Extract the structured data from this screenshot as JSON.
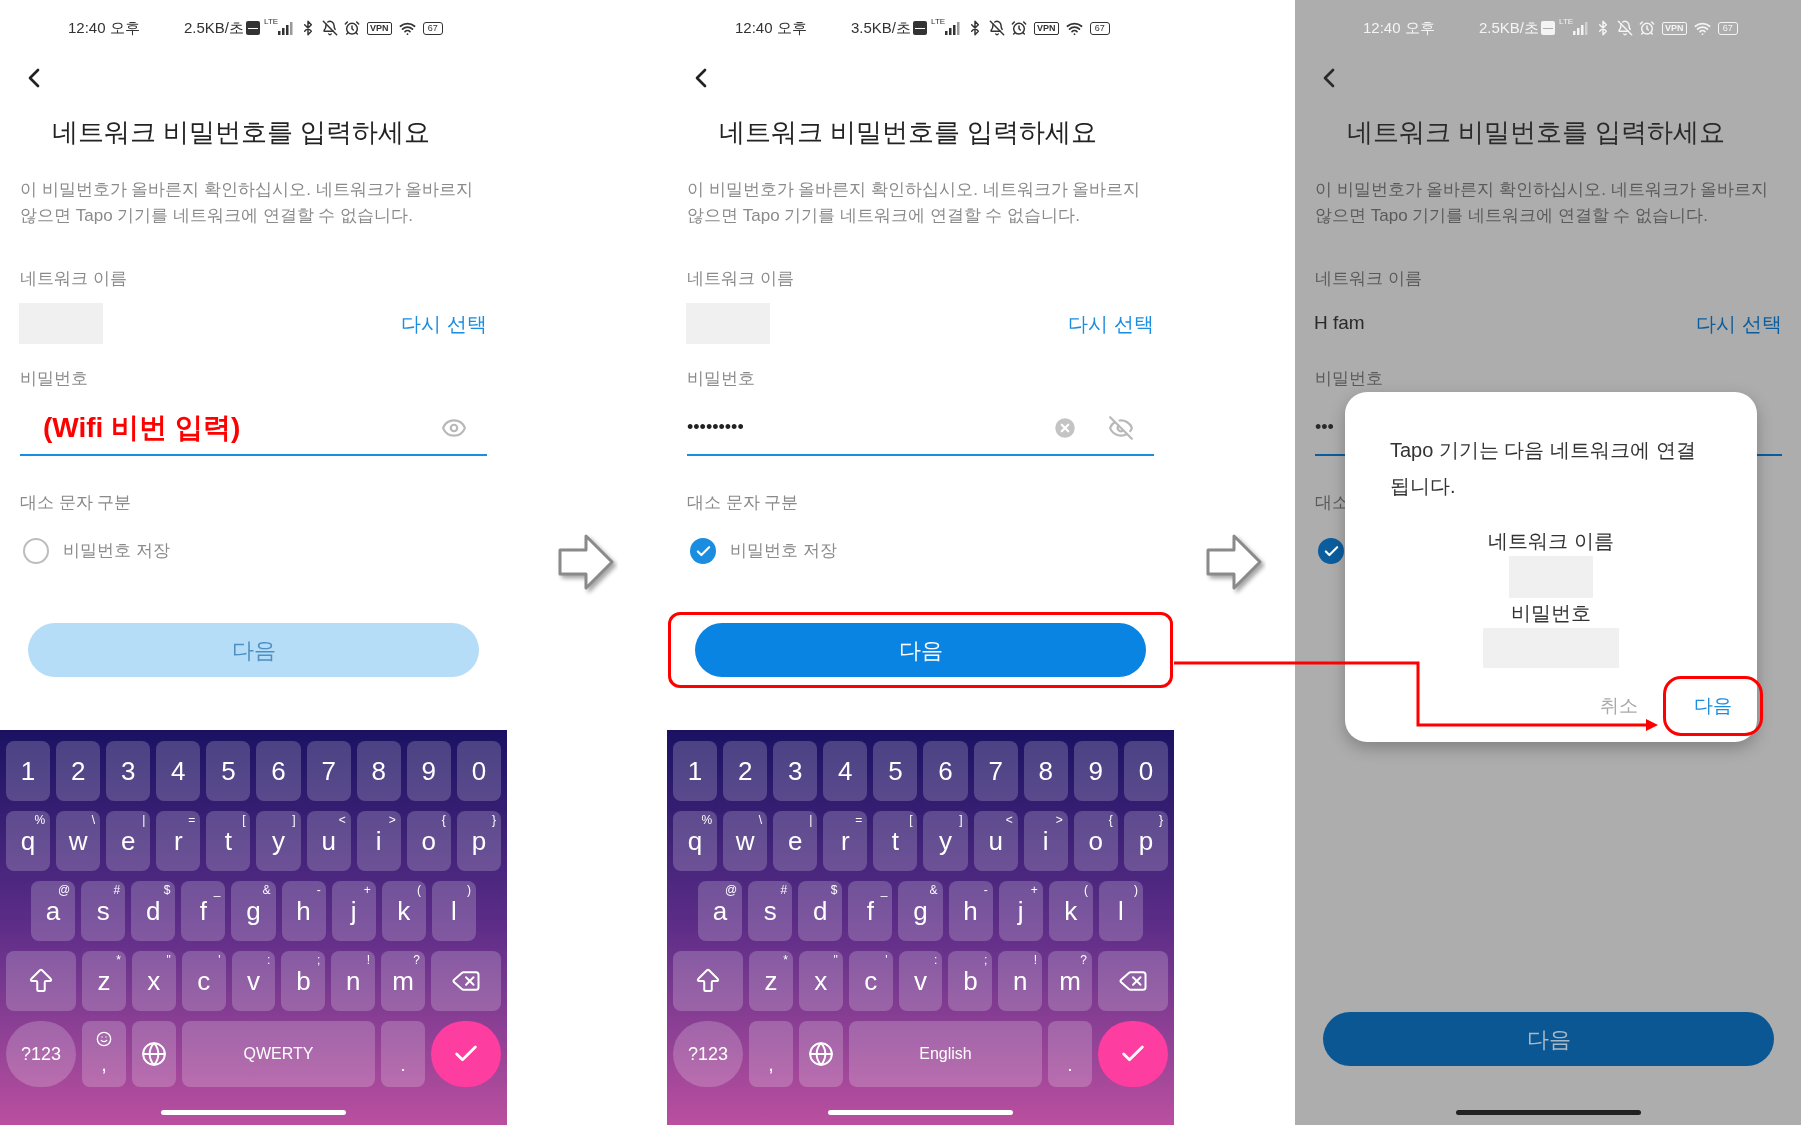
{
  "panels": [
    {
      "dimmed": false,
      "status_bar": {
        "time": "12:40 오후",
        "speed": "2.5KB/초",
        "lte": "LTE",
        "vpn": "VPN",
        "battery": "67"
      },
      "title": "네트워크 비밀번호를 입력하세요",
      "description": "이 비밀번호가 올바른지 확인하십시오. 네트워크가 올바르지 않으면 Tapo 기기를 네트워크에 연결할 수 없습니다.",
      "network_label": "네트워크 이름",
      "network_name": {
        "redacted": true
      },
      "reselect_link": "다시 선택",
      "password_label": "비밀번호",
      "password_field": {
        "annotation": "(Wifi 비번 입력)",
        "clear_button": false,
        "masked": true
      },
      "case_label": "대소 문자 구분",
      "save_password": {
        "label": "비밀번호 저장",
        "checked": false
      },
      "next_button": {
        "label": "다음",
        "enabled": false,
        "highlighted": false
      },
      "keyboard": {
        "number_row": [
          "1",
          "2",
          "3",
          "4",
          "5",
          "6",
          "7",
          "8",
          "9",
          "0"
        ],
        "letter_rows": [
          [
            {
              "key": "q",
              "hint": "%"
            },
            {
              "key": "w",
              "hint": "\\"
            },
            {
              "key": "e",
              "hint": "|"
            },
            {
              "key": "r",
              "hint": "="
            },
            {
              "key": "t",
              "hint": "["
            },
            {
              "key": "y",
              "hint": "]"
            },
            {
              "key": "u",
              "hint": "<"
            },
            {
              "key": "i",
              "hint": ">"
            },
            {
              "key": "o",
              "hint": "{"
            },
            {
              "key": "p",
              "hint": "}"
            }
          ],
          [
            {
              "key": "a",
              "hint": "@"
            },
            {
              "key": "s",
              "hint": "#"
            },
            {
              "key": "d",
              "hint": "$"
            },
            {
              "key": "f",
              "hint": "_"
            },
            {
              "key": "g",
              "hint": "&"
            },
            {
              "key": "h",
              "hint": "-"
            },
            {
              "key": "j",
              "hint": "+"
            },
            {
              "key": "k",
              "hint": "("
            },
            {
              "key": "l",
              "hint": ")"
            }
          ],
          [
            {
              "key": "z",
              "hint": "*"
            },
            {
              "key": "x",
              "hint": "\""
            },
            {
              "key": "c",
              "hint": "'"
            },
            {
              "key": "v",
              "hint": ":"
            },
            {
              "key": "b",
              "hint": ";"
            },
            {
              "key": "n",
              "hint": "!"
            },
            {
              "key": "m",
              "hint": "?"
            }
          ]
        ],
        "symbols_key": "?123",
        "comma_key": {
          "label": ",",
          "emoji": true
        },
        "space_label": "QWERTY",
        "period_key": "."
      }
    },
    {
      "dimmed": false,
      "status_bar": {
        "time": "12:40 오후",
        "speed": "3.5KB/초",
        "lte": "LTE",
        "vpn": "VPN",
        "battery": "67"
      },
      "title": "네트워크 비밀번호를 입력하세요",
      "description": "이 비밀번호가 올바른지 확인하십시오. 네트워크가 올바르지 않으면 Tapo 기기를 네트워크에 연결할 수 없습니다.",
      "network_label": "네트워크 이름",
      "network_name": {
        "redacted": true
      },
      "reselect_link": "다시 선택",
      "password_label": "비밀번호",
      "password_field": {
        "value": "•••••••••",
        "clear_button": true,
        "masked": false
      },
      "case_label": "대소 문자 구분",
      "save_password": {
        "label": "비밀번호 저장",
        "checked": true
      },
      "next_button": {
        "label": "다음",
        "enabled": true,
        "highlighted": true
      },
      "keyboard": {
        "number_row": [
          "1",
          "2",
          "3",
          "4",
          "5",
          "6",
          "7",
          "8",
          "9",
          "0"
        ],
        "letter_rows": [
          [
            {
              "key": "q",
              "hint": "%"
            },
            {
              "key": "w",
              "hint": "\\"
            },
            {
              "key": "e",
              "hint": "|"
            },
            {
              "key": "r",
              "hint": "="
            },
            {
              "key": "t",
              "hint": "["
            },
            {
              "key": "y",
              "hint": "]"
            },
            {
              "key": "u",
              "hint": "<"
            },
            {
              "key": "i",
              "hint": ">"
            },
            {
              "key": "o",
              "hint": "{"
            },
            {
              "key": "p",
              "hint": "}"
            }
          ],
          [
            {
              "key": "a",
              "hint": "@"
            },
            {
              "key": "s",
              "hint": "#"
            },
            {
              "key": "d",
              "hint": "$"
            },
            {
              "key": "f",
              "hint": "_"
            },
            {
              "key": "g",
              "hint": "&"
            },
            {
              "key": "h",
              "hint": "-"
            },
            {
              "key": "j",
              "hint": "+"
            },
            {
              "key": "k",
              "hint": "("
            },
            {
              "key": "l",
              "hint": ")"
            }
          ],
          [
            {
              "key": "z",
              "hint": "*"
            },
            {
              "key": "x",
              "hint": "\""
            },
            {
              "key": "c",
              "hint": "'"
            },
            {
              "key": "v",
              "hint": ":"
            },
            {
              "key": "b",
              "hint": ";"
            },
            {
              "key": "n",
              "hint": "!"
            },
            {
              "key": "m",
              "hint": "?"
            }
          ]
        ],
        "symbols_key": "?123",
        "comma_key": {
          "label": ",",
          "emoji": false
        },
        "space_label": "English",
        "period_key": "."
      }
    },
    {
      "dimmed": true,
      "status_bar": {
        "time": "12:40 오후",
        "speed": "2.5KB/초",
        "lte": "LTE",
        "vpn": "VPN",
        "battery": "67"
      },
      "title": "네트워크 비밀번호를 입력하세요",
      "description": "이 비밀번호가 올바른지 확인하십시오. 네트워크가 올바르지 않으면 Tapo 기기를 네트워크에 연결할 수 없습니다.",
      "network_label": "네트워크 이름",
      "network_name": {
        "redacted": false,
        "value": "H fam"
      },
      "reselect_link": "다시 선택",
      "password_label": "비밀번호",
      "password_field": {
        "value": "•••",
        "clear_button": false
      },
      "case_label": "대소",
      "save_password": {
        "checked": true
      },
      "next_button": {
        "label": "다음",
        "enabled": true,
        "highlighted": false
      },
      "dialog": {
        "message": "Tapo 기기는 다음 네트워크에 연결 됩니다.",
        "network_label": "네트워크 이름",
        "password_label": "비밀번호",
        "actions": [
          {
            "label": "취소",
            "kind": "cancel",
            "highlighted": false
          },
          {
            "label": "다음",
            "kind": "confirm",
            "highlighted": true
          }
        ]
      }
    }
  ]
}
